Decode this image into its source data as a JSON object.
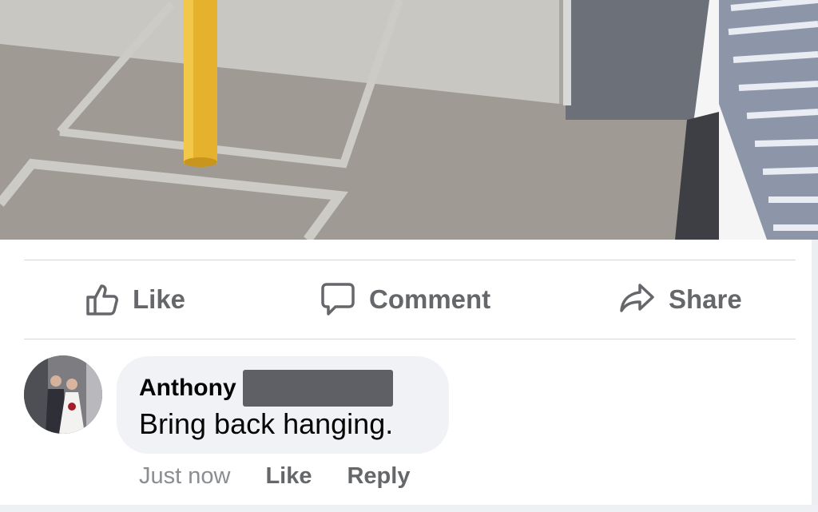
{
  "post": {
    "photo_description_icon": "post-photo"
  },
  "actions": {
    "like_label": "Like",
    "comment_label": "Comment",
    "share_label": "Share",
    "like_icon": "thumbs-up-icon",
    "comment_icon": "speech-bubble-icon",
    "share_icon": "share-arrow-icon"
  },
  "comment": {
    "author": "Anthony",
    "text": "Bring back hanging.",
    "time": "Just now",
    "like_label": "Like",
    "reply_label": "Reply"
  },
  "colors": {
    "action_text": "#65676b",
    "bubble_bg": "#f0f2f5",
    "divider": "#d6d8dc",
    "timestamp": "#8a8d91"
  }
}
